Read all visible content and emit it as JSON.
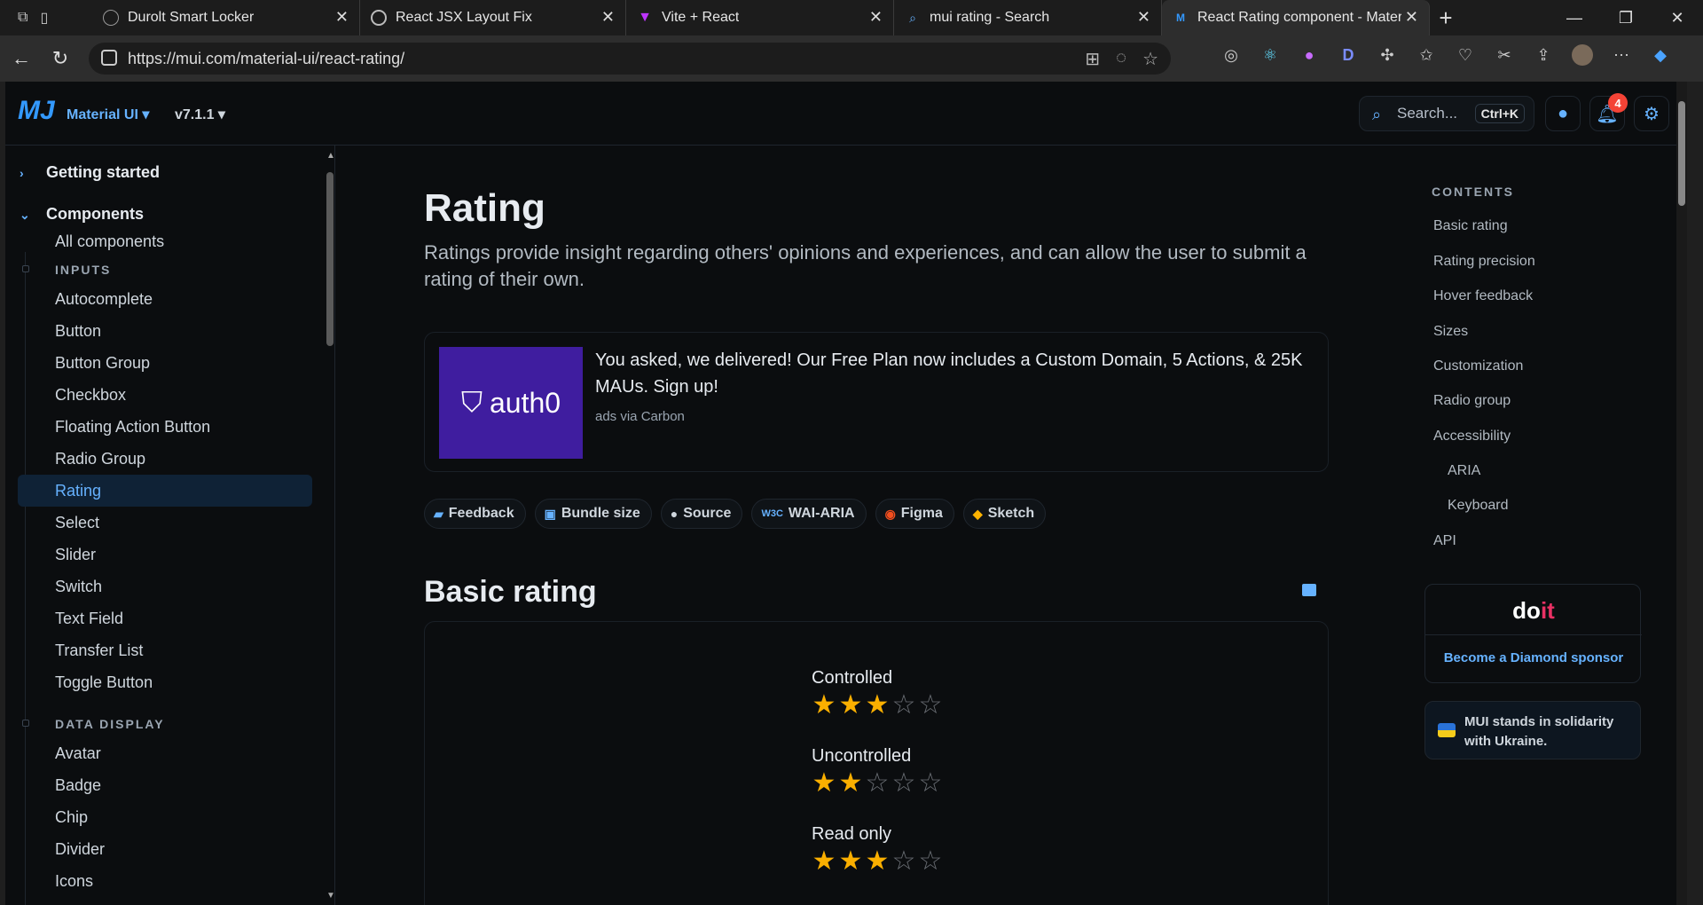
{
  "browser": {
    "tabs": [
      {
        "title": "Durolt Smart Locker",
        "icon": "globe-icon"
      },
      {
        "title": "React JSX Layout Fix",
        "icon": "chatgpt-icon"
      },
      {
        "title": "Vite + React",
        "icon": "vite-icon"
      },
      {
        "title": "mui rating - Search",
        "icon": "search-icon"
      },
      {
        "title": "React Rating component - Material UI",
        "icon": "mui-icon"
      }
    ],
    "url": "https://mui.com/material-ui/react-rating/"
  },
  "header": {
    "brand": "Material UI",
    "version": "v7.1.1",
    "search_placeholder": "Search...",
    "shortcut": "Ctrl+K",
    "notifications_count": "4"
  },
  "sidebar": {
    "getting_started": "Getting started",
    "components": "Components",
    "all_components": "All components",
    "inputs_heading": "INPUTS",
    "inputs": [
      "Autocomplete",
      "Button",
      "Button Group",
      "Checkbox",
      "Floating Action Button",
      "Radio Group",
      "Rating",
      "Select",
      "Slider",
      "Switch",
      "Text Field",
      "Transfer List",
      "Toggle Button"
    ],
    "data_display_heading": "DATA DISPLAY",
    "data_display": [
      "Avatar",
      "Badge",
      "Chip",
      "Divider",
      "Icons"
    ],
    "active": "Rating"
  },
  "main": {
    "title": "Rating",
    "description": "Ratings provide insight regarding others' opinions and experiences, and can allow the user to submit a rating of their own.",
    "ad": {
      "logo_text": "auth0",
      "text": "You asked, we delivered! Our Free Plan now includes a Custom Domain, 5 Actions, & 25K MAUs. Sign up!",
      "via": "ads via Carbon"
    },
    "chips": [
      "Feedback",
      "Bundle size",
      "Source",
      "WAI-ARIA",
      "Figma",
      "Sketch"
    ],
    "section_title": "Basic rating",
    "ratings": [
      {
        "label": "Controlled",
        "value": 3,
        "max": 5
      },
      {
        "label": "Uncontrolled",
        "value": 2,
        "max": 5
      },
      {
        "label": "Read only",
        "value": 3,
        "max": 5
      }
    ]
  },
  "toc": {
    "heading": "CONTENTS",
    "items": [
      "Basic rating",
      "Rating precision",
      "Hover feedback",
      "Sizes",
      "Customization",
      "Radio group",
      "Accessibility",
      "ARIA",
      "Keyboard",
      "API"
    ]
  },
  "sponsor": {
    "logo_a": "do",
    "logo_b": "it",
    "link": "Become a Diamond sponsor"
  },
  "ukraine": {
    "text": "MUI stands in solidarity with Ukraine."
  },
  "colors": {
    "accent": "#66b2ff",
    "star": "#faaf00",
    "background": "#0b0d0f"
  }
}
